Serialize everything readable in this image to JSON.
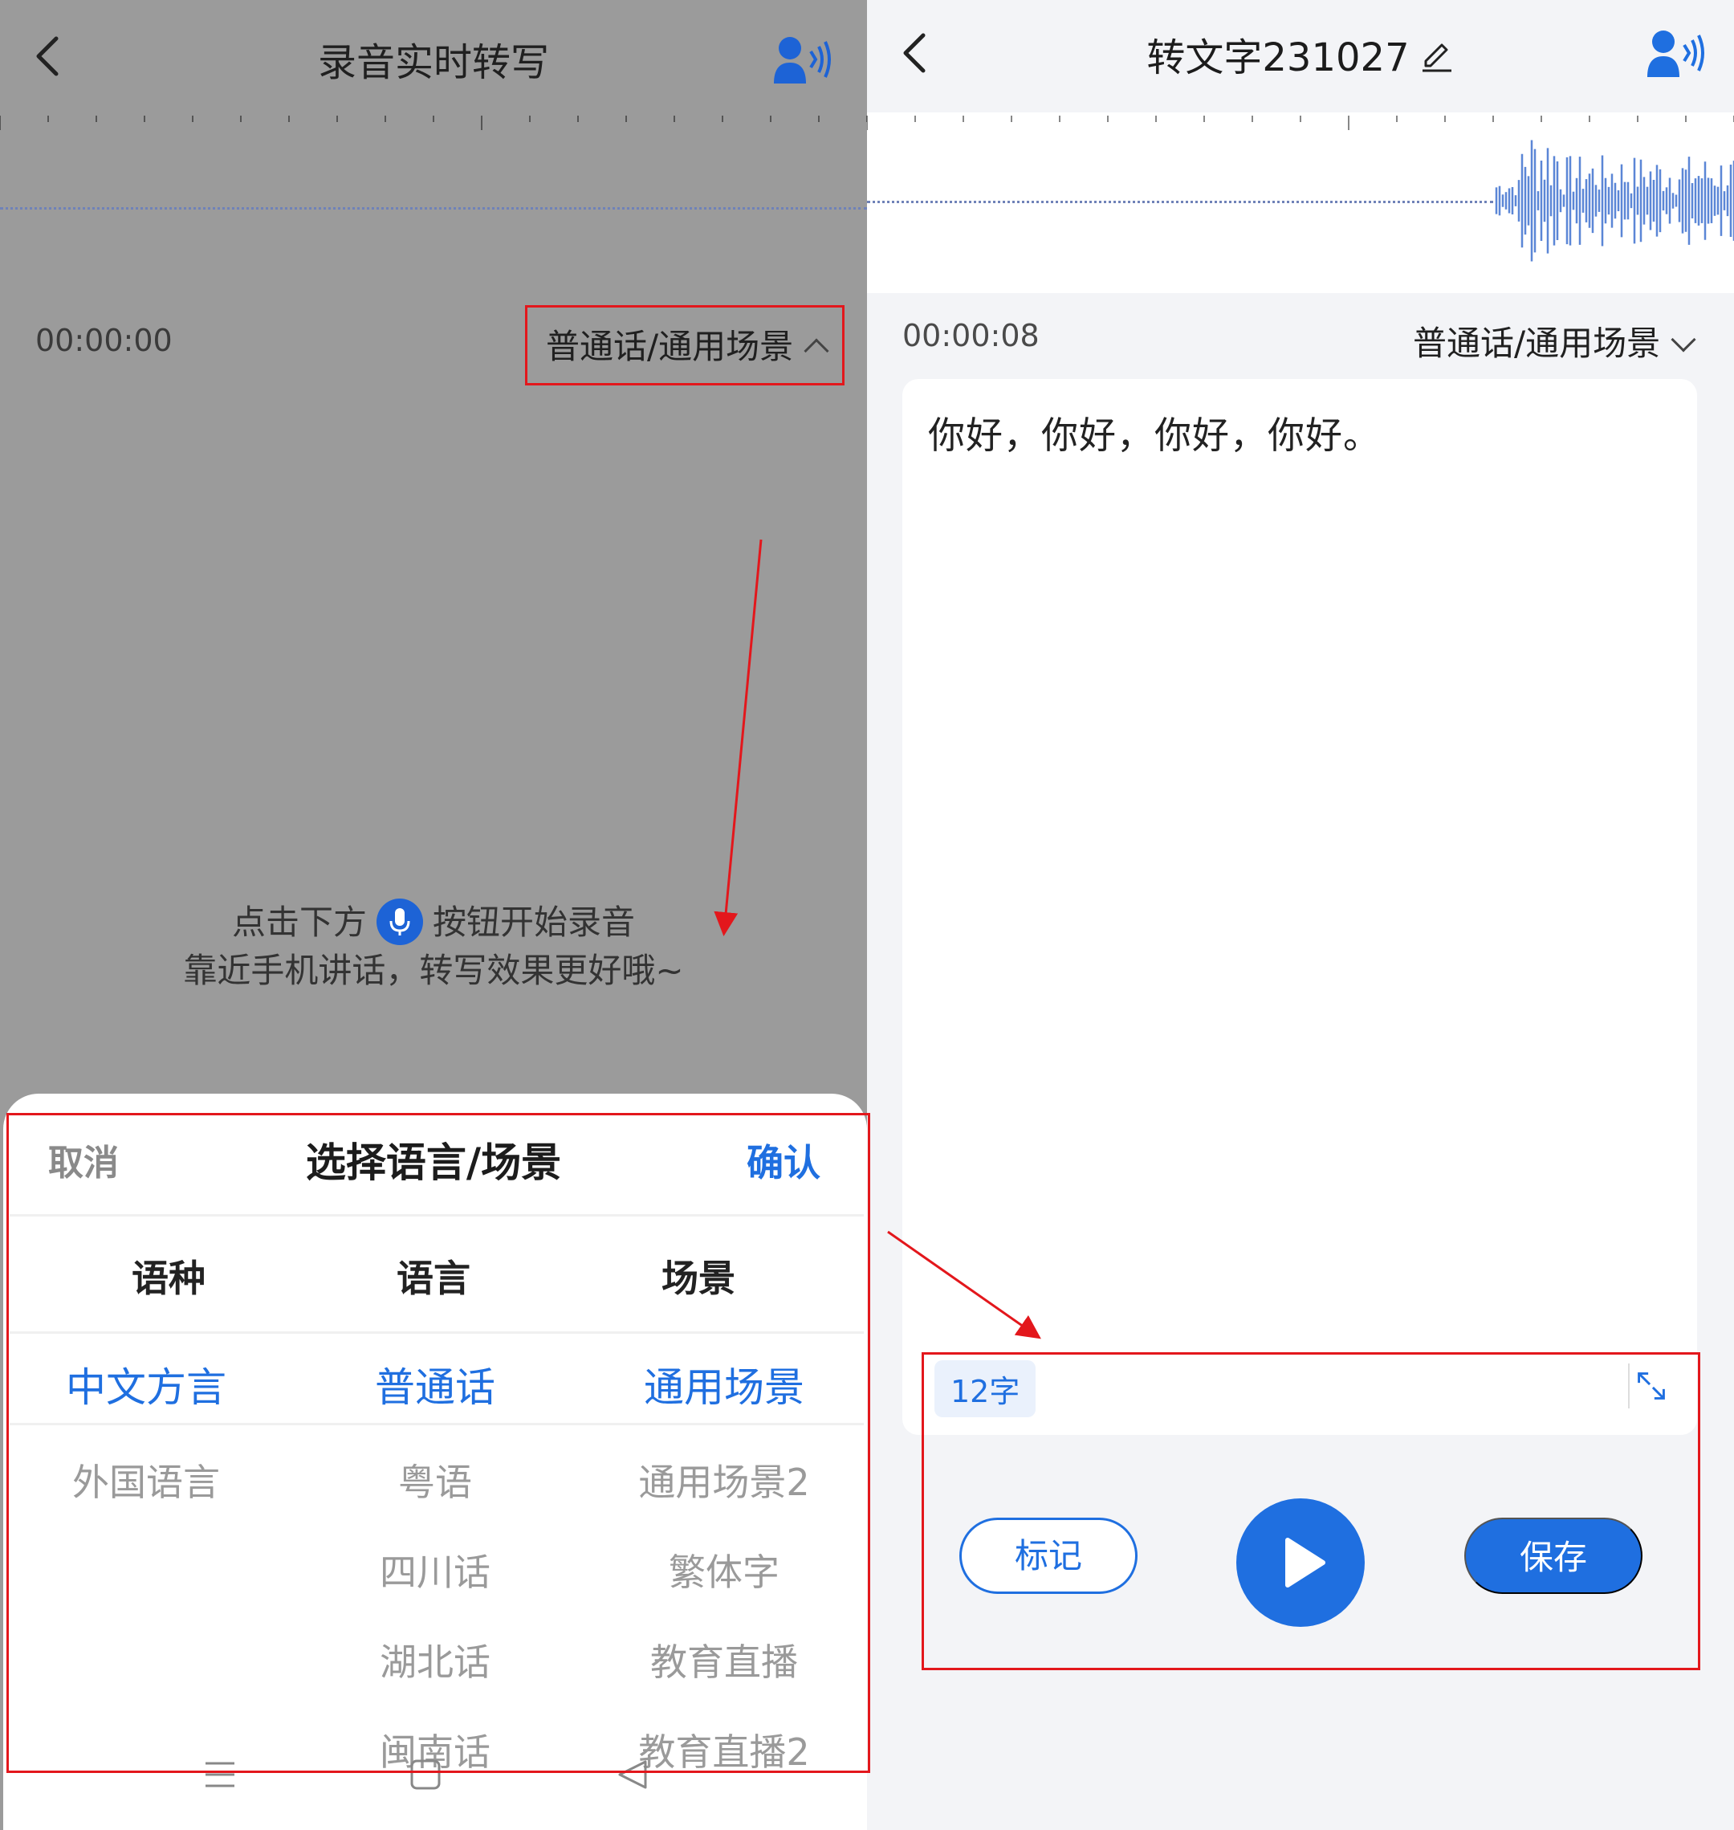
{
  "left": {
    "title": "录音实时转写",
    "time": "00:00:00",
    "lang_selector": "普通话/通用场景",
    "hint_before": "点击下方",
    "hint_after": "按钮开始录音",
    "hint_line2": "靠近手机讲话，转写效果更好哦~",
    "sheet": {
      "cancel": "取消",
      "title": "选择语言/场景",
      "confirm": "确认",
      "columns": [
        "语种",
        "语言",
        "场景"
      ],
      "col1": {
        "selected": "中文方言",
        "options": [
          "外国语言"
        ]
      },
      "col2": {
        "selected": "普通话",
        "options": [
          "粤语",
          "四川话",
          "湖北话",
          "闽南话"
        ]
      },
      "col3": {
        "selected": "通用场景",
        "options": [
          "通用场景2",
          "繁体字",
          "教育直播",
          "教育直播2"
        ]
      }
    }
  },
  "right": {
    "title": "转文字231027",
    "time": "00:00:08",
    "lang_selector": "普通话/通用场景",
    "transcript": "你好，你好，你好，你好。",
    "char_count": "12字",
    "mark_label": "标记",
    "save_label": "保存"
  },
  "icons": {
    "back": "chevron-left-icon",
    "voice": "speaker-voice-icon",
    "mic": "microphone-icon",
    "edit": "pencil-icon",
    "expand": "expand-icon",
    "play": "play-icon"
  },
  "colors": {
    "accent": "#1f6fe0",
    "annotation": "#e3171c",
    "overlay": "#9b9b9b"
  }
}
